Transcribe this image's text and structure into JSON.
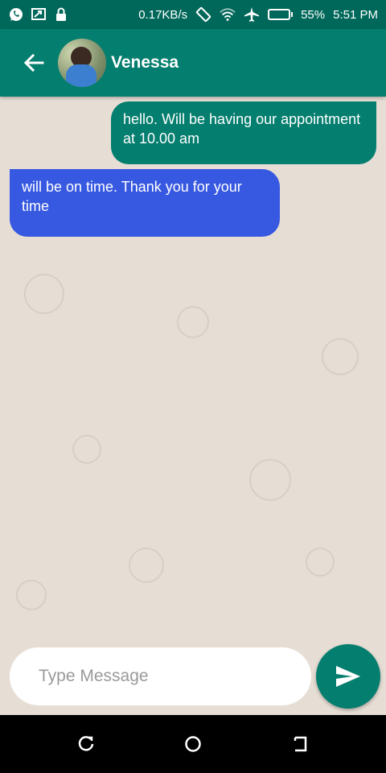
{
  "status_bar": {
    "network_speed": "0.17KB/s",
    "battery_percent": "55%",
    "battery_level": 0.55,
    "time": "5:51 PM",
    "icons": [
      "whatsapp-icon",
      "screen-cast-icon",
      "lock-icon",
      "auto-rotate-icon",
      "wifi-icon",
      "airplane-icon",
      "battery-icon"
    ]
  },
  "header": {
    "contact_name": "Venessa",
    "back_icon": "arrow-left-icon"
  },
  "messages": [
    {
      "direction": "outgoing",
      "text": "hello.  Will be having our appointment  at 10.00 am",
      "color": "#047e6e"
    },
    {
      "direction": "incoming",
      "text": "will be on time. Thank you for your time",
      "color": "#3758e0"
    }
  ],
  "composer": {
    "placeholder": "Type Message",
    "value": "",
    "send_icon": "send-icon"
  },
  "nav_bar": {
    "icons": [
      "recents-icon",
      "home-icon",
      "back-nav-icon"
    ]
  },
  "colors": {
    "primary": "#047e6e",
    "status_bar": "#00685a",
    "incoming_bubble": "#3758e0",
    "wallpaper": "#e6ded5"
  }
}
